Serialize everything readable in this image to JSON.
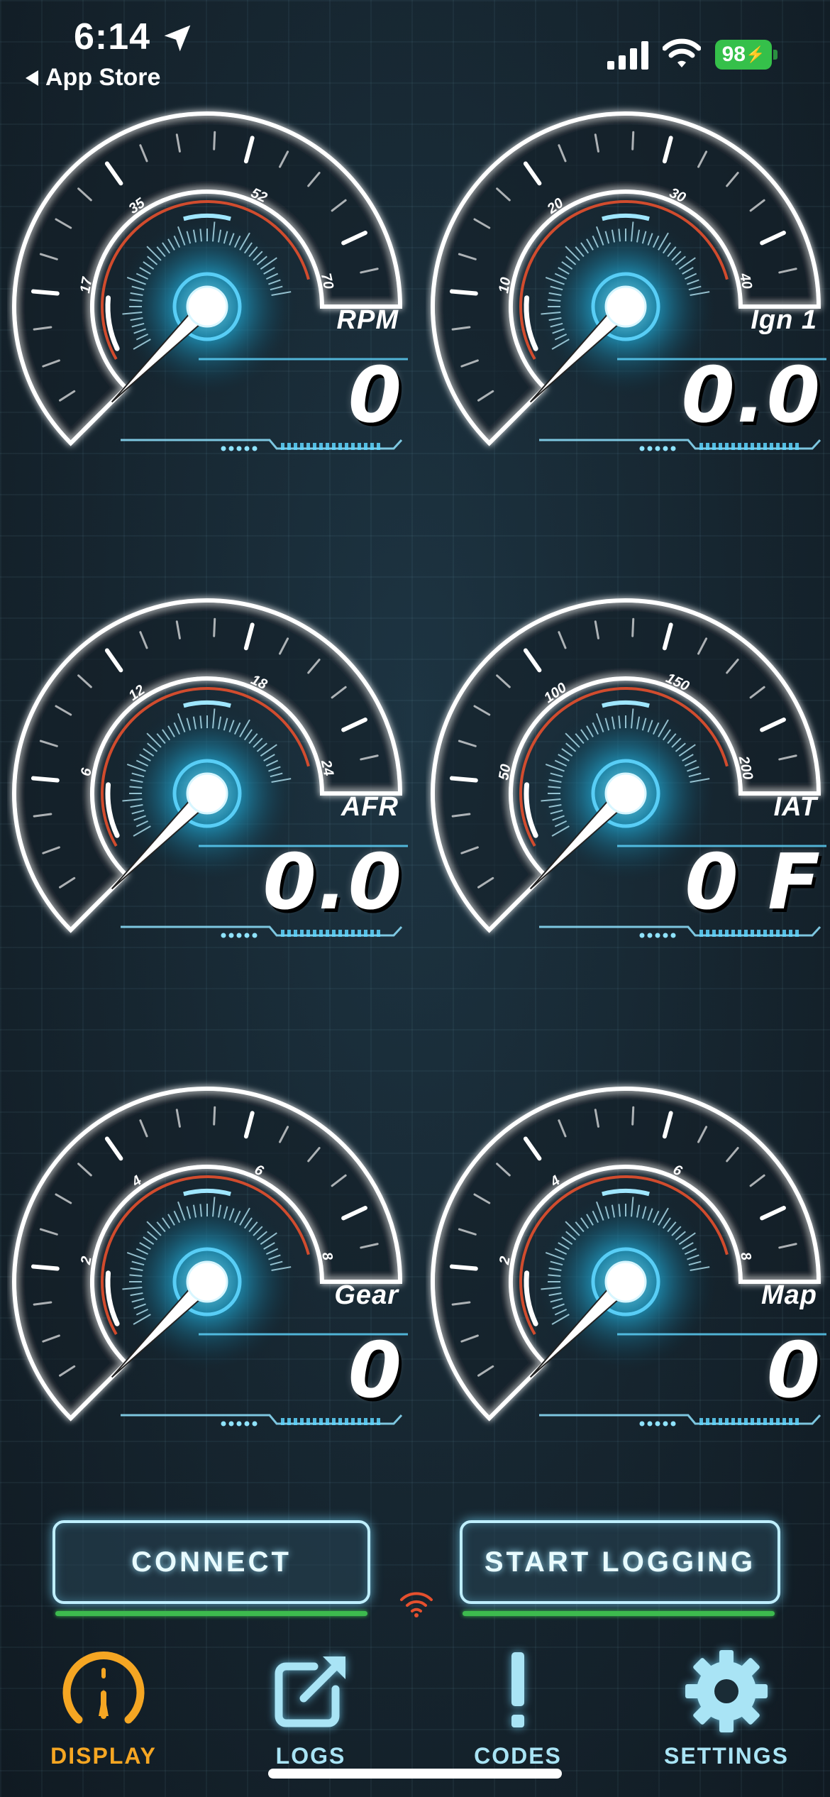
{
  "status_bar": {
    "time": "6:14",
    "back_label": "App Store",
    "battery": "98"
  },
  "gauges": [
    {
      "label": "RPM",
      "value": "0",
      "ticks": [
        "17",
        "35",
        "52",
        "70"
      ]
    },
    {
      "label": "Ign 1",
      "value": "0.0",
      "ticks": [
        "10",
        "20",
        "30",
        "40"
      ]
    },
    {
      "label": "AFR",
      "value": "0.0",
      "ticks": [
        "6",
        "12",
        "18",
        "24"
      ]
    },
    {
      "label": "IAT",
      "value": "0 F",
      "ticks": [
        "50",
        "100",
        "150",
        "200"
      ]
    },
    {
      "label": "Gear",
      "value": "0",
      "ticks": [
        "2",
        "4",
        "6",
        "8"
      ]
    },
    {
      "label": "Map",
      "value": "0",
      "ticks": [
        "2",
        "4",
        "6",
        "8"
      ]
    }
  ],
  "buttons": {
    "connect": "CONNECT",
    "start_logging": "START LOGGING"
  },
  "tabs": [
    {
      "label": "DISPLAY",
      "icon": "gauge-icon",
      "active": true
    },
    {
      "label": "LOGS",
      "icon": "export-icon",
      "active": false
    },
    {
      "label": "CODES",
      "icon": "exclamation-icon",
      "active": false
    },
    {
      "label": "SETTINGS",
      "icon": "gear-icon",
      "active": false
    }
  ],
  "colors": {
    "accent_active": "#f5a623",
    "accent_inactive": "#a9e4f5",
    "glow": "#6ad6ff",
    "red_arc": "#e5502e",
    "connected_bar": "#3dbb4e"
  }
}
